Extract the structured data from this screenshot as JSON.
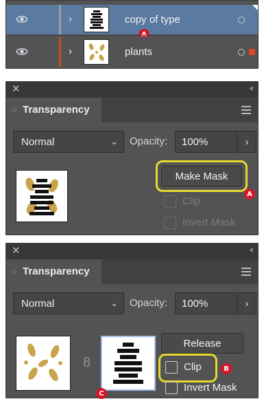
{
  "layers_panel": {
    "rows": [
      {
        "name": "copy of type",
        "selected": true,
        "color": "#9aa0a6",
        "thumb_text": "FOR EVERY TIME ICE AKE FOR ARE ICE FREEDOM"
      },
      {
        "name": "plants",
        "selected": false,
        "color": "#c2531b"
      }
    ],
    "badge": "A",
    "selection_color": "#e2452a"
  },
  "panel1": {
    "title": "Transparency",
    "blend_mode": "Normal",
    "opacity_label": "Opacity:",
    "opacity_value": "100%",
    "make_mask_button": "Make Mask",
    "clip_label": "Clip",
    "invert_mask_label": "Invert Mask",
    "badge": "A",
    "thumb_text": "FOR EVERY TIME ICE AKE FOR ARE ICE FREEDOM"
  },
  "panel2": {
    "title": "Transparency",
    "blend_mode": "Normal",
    "opacity_label": "Opacity:",
    "opacity_value": "100%",
    "release_button": "Release",
    "clip_label": "Clip",
    "invert_mask_label": "Invert Mask",
    "badge_b": "B",
    "badge_c": "C",
    "mask_thumb_text": "FOR EVERY TIME ICE AKE FOR ARE ICE FREEDOM"
  },
  "icons": {
    "visibility": "eye-icon",
    "expand": "chevron-right-icon",
    "menu": "hamburger-menu-icon",
    "close": "close-icon",
    "collapse": "double-chevron-icon",
    "link": "chain-link-icon"
  },
  "colors": {
    "panel_bg": "#535353",
    "selected_row": "#5a7aa0",
    "highlight": "#e6da2e",
    "badge": "#d7142b"
  }
}
